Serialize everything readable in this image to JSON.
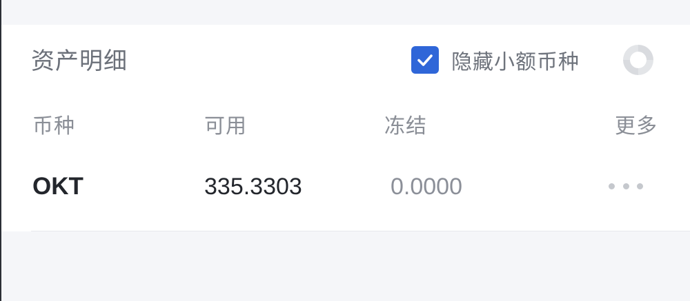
{
  "section": {
    "title": "资产明细",
    "hide_small_label": "隐藏小额币种",
    "hide_small_checked": true
  },
  "table": {
    "headers": [
      "币种",
      "可用",
      "冻结",
      "更多"
    ],
    "rows": [
      {
        "coin": "OKT",
        "available": "335.3303",
        "frozen": "0.0000"
      }
    ]
  },
  "colors": {
    "accent": "#2f66d8",
    "primary_text": "#23262c",
    "secondary_text": "#8a8e96",
    "background": "#f5f6f9"
  },
  "icons": {
    "checkbox": "check-icon",
    "loader": "spinner-icon",
    "more": "more-dots-icon"
  }
}
